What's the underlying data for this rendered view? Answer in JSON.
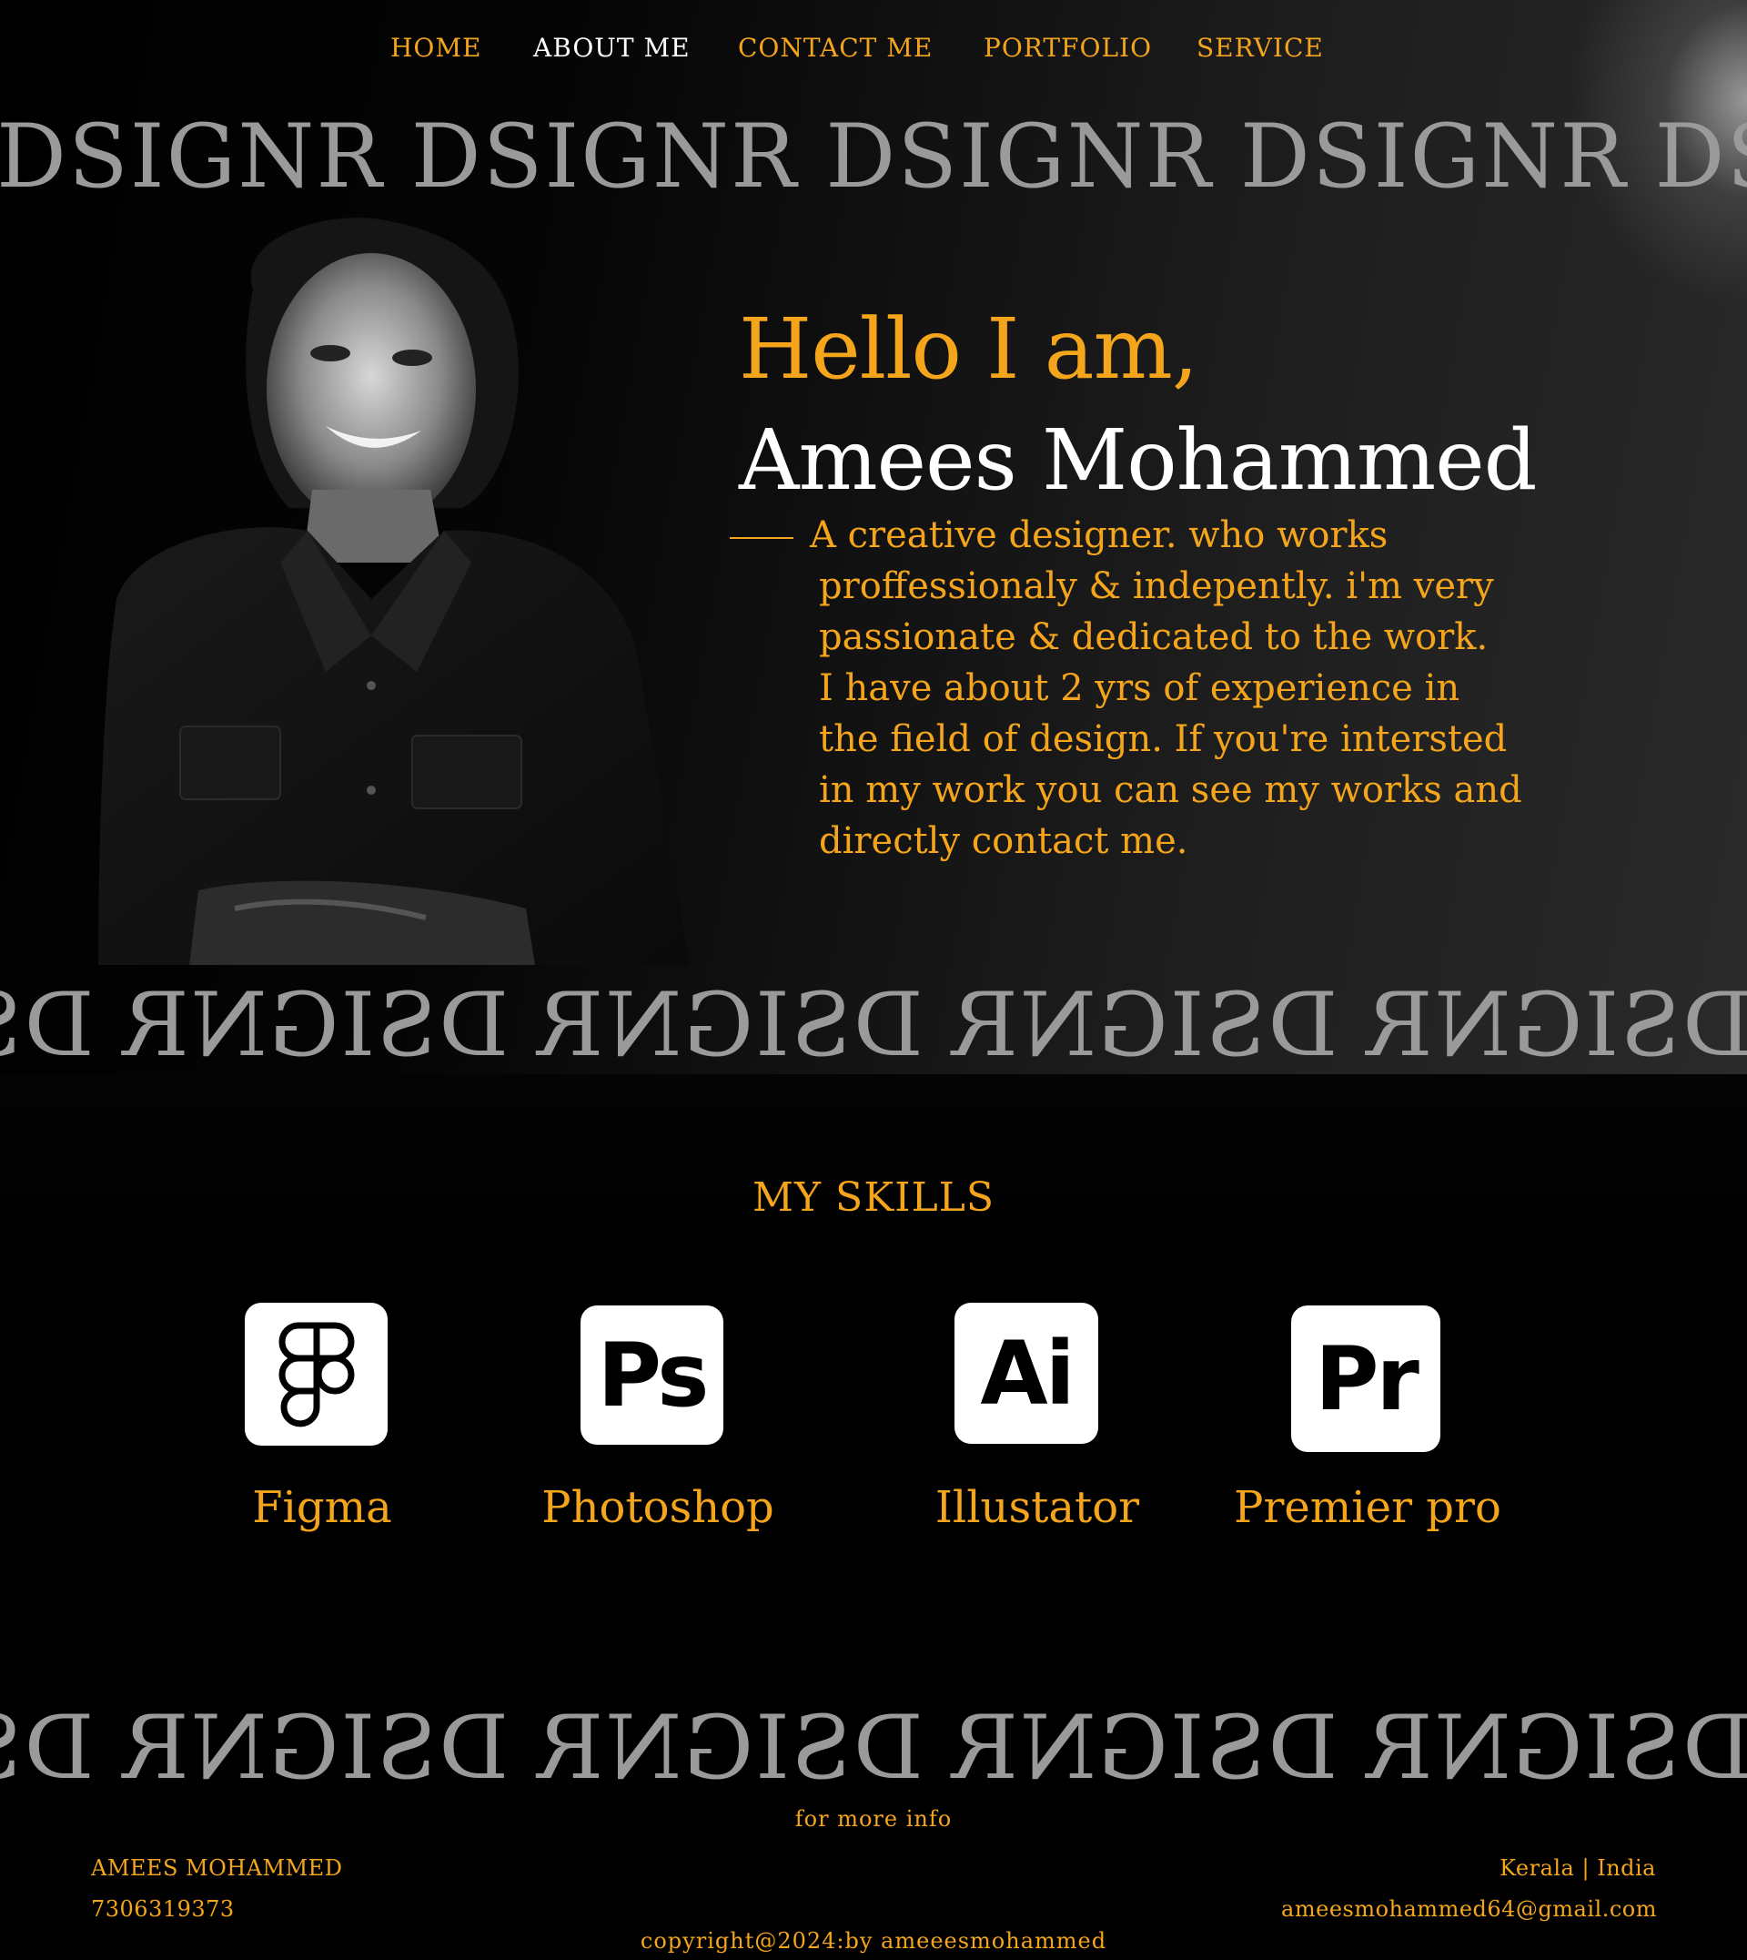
{
  "nav": {
    "items": [
      {
        "label": "HOME"
      },
      {
        "label": "ABOUT ME"
      },
      {
        "label": "CONTACT ME"
      },
      {
        "label": "PORTFOLIO"
      },
      {
        "label": "SERVICE"
      }
    ],
    "active": "ABOUT ME"
  },
  "banner": {
    "word": "DSIGNR"
  },
  "hero": {
    "greeting": "Hello I am,",
    "name": "Amees Mohammed",
    "bio_lines": [
      "A creative designer. who works",
      "proffessionaly & indepently. i'm very",
      "passionate & dedicated to the work.",
      "I have about 2 yrs of experience in",
      "the field of design. If you're intersted",
      "in my work you can see my works and",
      "directly contact me."
    ]
  },
  "skills": {
    "title": "MY SKILLS",
    "items": [
      {
        "name": "Figma",
        "icon": "figma-icon"
      },
      {
        "name": "Photoshop",
        "icon": "photoshop-icon",
        "abbr": "Ps"
      },
      {
        "name": "Illustator",
        "icon": "illustrator-icon",
        "abbr": "Ai"
      },
      {
        "name": "Premier pro",
        "icon": "premiere-pro-icon",
        "abbr": "Pr"
      }
    ]
  },
  "footer": {
    "more_info": "for more info",
    "name": "AMEES MOHAMMED",
    "phone": "7306319373",
    "location": "Kerala | India",
    "email": "ameesmohammed64@gmail.com",
    "copyright": "copyright@2024:by ameeesmohammed"
  },
  "colors": {
    "accent": "#f4a51c",
    "background": "#000000",
    "banner_text": "#9a9a9a",
    "active_nav": "#ffffff"
  }
}
